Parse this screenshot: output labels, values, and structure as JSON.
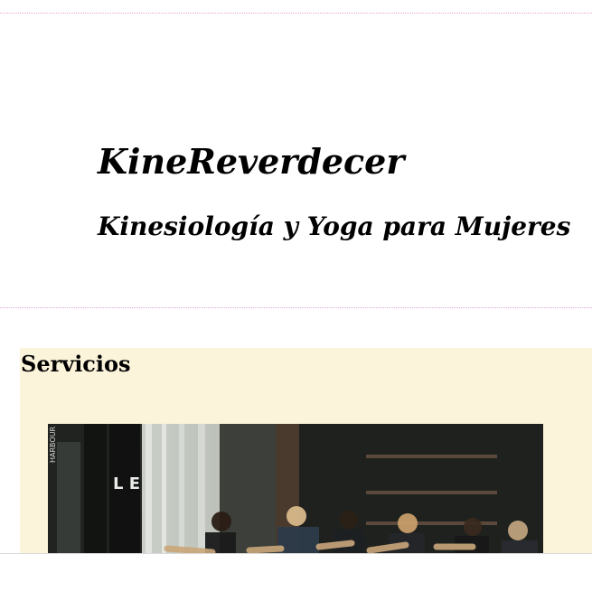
{
  "header": {
    "title": "KineReverdecer",
    "subtitle": "Kinesiología y Yoga para Mujeres"
  },
  "services": {
    "heading": "Servicios",
    "image": {
      "alt": "yoga-class-photo",
      "partial_text": [
        "HARBOUR",
        "L E R V"
      ]
    }
  },
  "colors": {
    "divider": "#e3a5d2",
    "section_bg": "#fbf3da"
  }
}
